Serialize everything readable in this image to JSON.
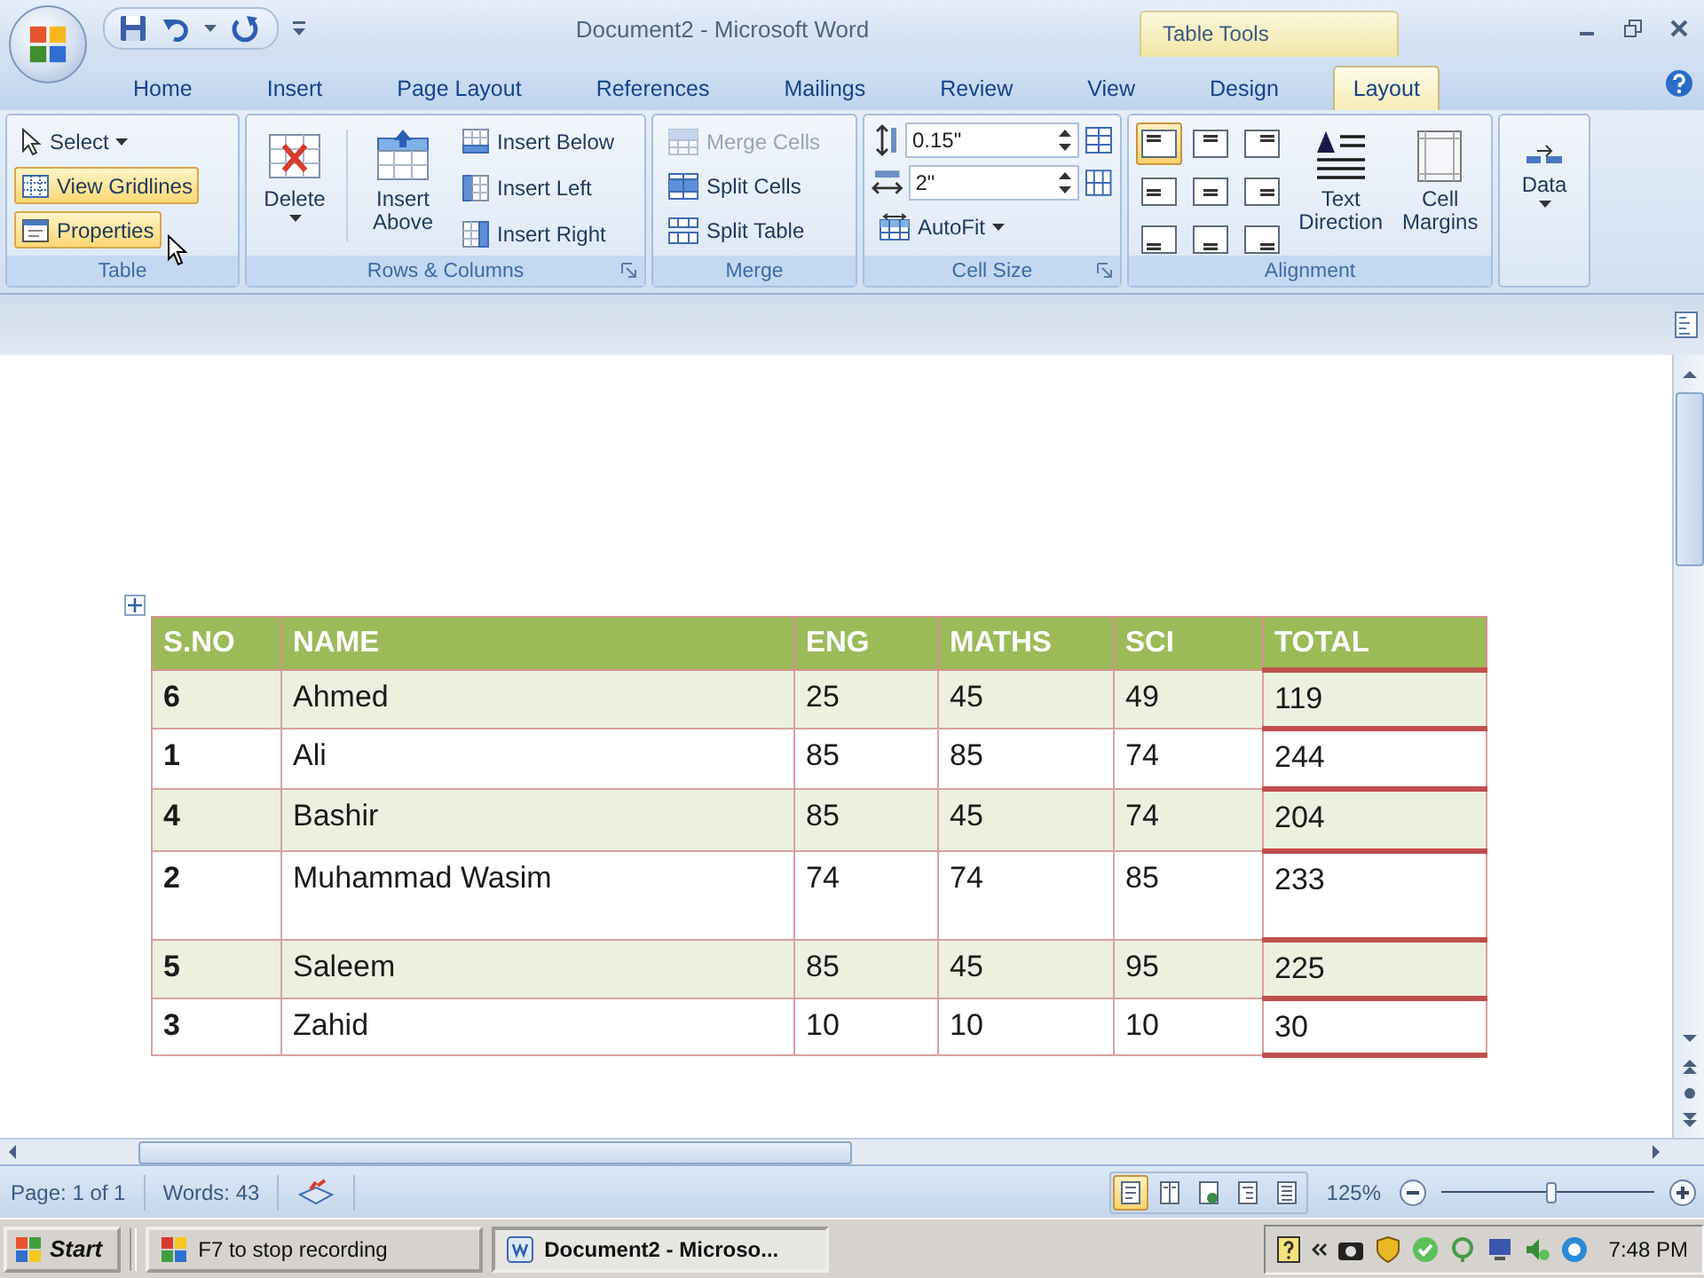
{
  "window": {
    "title": "Document2 - Microsoft Word",
    "context_title": "Table Tools"
  },
  "tabs": [
    {
      "label": "Home",
      "selected": false
    },
    {
      "label": "Insert",
      "selected": false
    },
    {
      "label": "Page Layout",
      "selected": false
    },
    {
      "label": "References",
      "selected": false
    },
    {
      "label": "Mailings",
      "selected": false
    },
    {
      "label": "Review",
      "selected": false
    },
    {
      "label": "View",
      "selected": false
    },
    {
      "label": "Design",
      "selected": false
    },
    {
      "label": "Layout",
      "selected": true
    }
  ],
  "ribbon": {
    "table": {
      "title": "Table",
      "select": "Select",
      "view_gridlines": {
        "label": "View Gridlines",
        "on": true
      },
      "properties": {
        "label": "Properties",
        "hovered": true
      }
    },
    "rows_columns": {
      "title": "Rows & Columns",
      "delete": "Delete",
      "insert_above": "Insert Above",
      "insert_below": "Insert Below",
      "insert_left": "Insert Left",
      "insert_right": "Insert Right"
    },
    "merge": {
      "title": "Merge",
      "items": [
        {
          "label": "Merge Cells",
          "disabled": true
        },
        {
          "label": "Split Cells",
          "disabled": false
        },
        {
          "label": "Split Table",
          "disabled": false
        }
      ]
    },
    "cell_size": {
      "title": "Cell Size",
      "height": "0.15\"",
      "width": "2\"",
      "autofit": "AutoFit"
    },
    "alignment": {
      "title": "Alignment",
      "buttons": [
        {
          "selected": true
        },
        {
          "selected": false
        },
        {
          "selected": false
        },
        {
          "selected": false
        },
        {
          "selected": false
        },
        {
          "selected": false
        },
        {
          "selected": false
        },
        {
          "selected": false
        },
        {
          "selected": false
        }
      ],
      "text_direction": "Text Direction",
      "cell_margins": "Cell Margins"
    },
    "data": {
      "label": "Data"
    }
  },
  "table": {
    "columns": [
      "S.NO",
      "NAME",
      "ENG",
      "MATHS",
      "SCI",
      "TOTAL"
    ],
    "rows": [
      [
        "6",
        "Ahmed",
        "25",
        "45",
        "49",
        "119"
      ],
      [
        "1",
        "Ali",
        "85",
        "85",
        "74",
        "244"
      ],
      [
        "4",
        "Bashir",
        "85",
        "45",
        "74",
        "204"
      ],
      [
        "2",
        "Muhammad Wasim",
        "74",
        "74",
        "85",
        "233"
      ],
      [
        "5",
        "Saleem",
        "85",
        "45",
        "95",
        "225"
      ],
      [
        "3",
        "Zahid",
        "10",
        "10",
        "10",
        "30"
      ]
    ]
  },
  "status_bar": {
    "page": "Page: 1 of 1",
    "words": "Words: 43",
    "views": [
      {
        "selected": true
      },
      {
        "selected": false
      },
      {
        "selected": false
      },
      {
        "selected": false
      },
      {
        "selected": false
      }
    ],
    "zoom": {
      "reading": "125%",
      "level": 0.52
    }
  },
  "taskbar": {
    "start": "Start",
    "tasks": [
      {
        "label": "F7 to stop recording",
        "selected": false
      },
      {
        "label": "Document2 - Microso...",
        "selected": true
      }
    ],
    "clock": "7:48 PM"
  }
}
